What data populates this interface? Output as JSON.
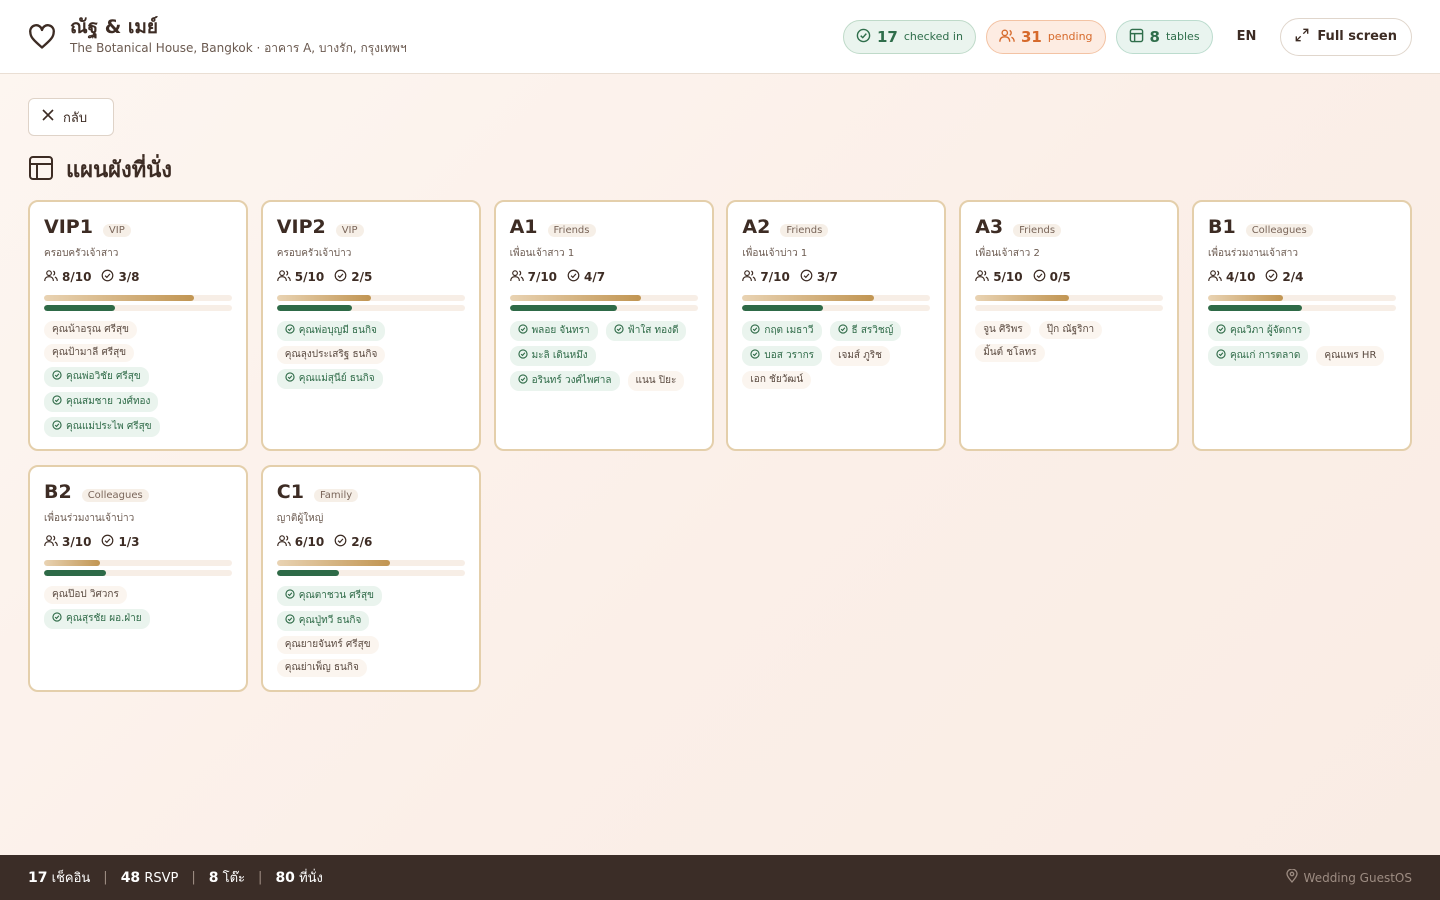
{
  "header": {
    "title": "ณัฐ & เมย์",
    "subtitle": "The Botanical House, Bangkok · อาคาร A, บางรัก, กรุงเทพฯ",
    "checked_in": {
      "count": "17",
      "label": "checked in"
    },
    "pending": {
      "count": "31",
      "label": "pending"
    },
    "tables": {
      "count": "8",
      "label": "tables"
    },
    "language": "EN",
    "fullscreen_label": "Full screen"
  },
  "back_label": "กลับ",
  "page_title": "แผนผังที่นั่ง",
  "tables": [
    {
      "name": "VIP1",
      "category": "VIP",
      "desc": "ครอบครัวเจ้าสาว",
      "seated": "8/10",
      "checked": "3/8",
      "seat_pct": 80,
      "check_pct": 37.5,
      "guests": [
        {
          "name": "คุณน้าอรุณ ศรีสุข",
          "checked": false
        },
        {
          "name": "คุณป้ามาลี ศรีสุข",
          "checked": false
        },
        {
          "name": "คุณพ่อวิชัย ศรีสุข",
          "checked": true
        },
        {
          "name": "คุณสมชาย วงศ์ทอง",
          "checked": true
        },
        {
          "name": "คุณแม่ประไพ ศรีสุข",
          "checked": true
        }
      ]
    },
    {
      "name": "VIP2",
      "category": "VIP",
      "desc": "ครอบครัวเจ้าบ่าว",
      "seated": "5/10",
      "checked": "2/5",
      "seat_pct": 50,
      "check_pct": 40,
      "guests": [
        {
          "name": "คุณพ่อบุญมี ธนกิจ",
          "checked": true
        },
        {
          "name": "คุณลุงประเสริฐ ธนกิจ",
          "checked": false
        },
        {
          "name": "คุณแม่สุนีย์ ธนกิจ",
          "checked": true
        }
      ]
    },
    {
      "name": "A1",
      "category": "Friends",
      "desc": "เพื่อนเจ้าสาว 1",
      "seated": "7/10",
      "checked": "4/7",
      "seat_pct": 70,
      "check_pct": 57,
      "guests": [
        {
          "name": "พลอย จันทรา",
          "checked": true
        },
        {
          "name": "ฟ้าใส ทองดี",
          "checked": true
        },
        {
          "name": "มะลิ เดินหมึง",
          "checked": true
        },
        {
          "name": "อรินทร์ วงศ์ไพศาล",
          "checked": true
        },
        {
          "name": "แนน ปิยะ",
          "checked": false
        }
      ]
    },
    {
      "name": "A2",
      "category": "Friends",
      "desc": "เพื่อนเจ้าบ่าว 1",
      "seated": "7/10",
      "checked": "3/7",
      "seat_pct": 70,
      "check_pct": 43,
      "guests": [
        {
          "name": "กฤต เมธาวี",
          "checked": true
        },
        {
          "name": "ธี สรวิชญ์",
          "checked": true
        },
        {
          "name": "บอส วรากร",
          "checked": true
        },
        {
          "name": "เจมส์ ภูริช",
          "checked": false
        },
        {
          "name": "เอก ชัยวัฒน์",
          "checked": false
        }
      ]
    },
    {
      "name": "A3",
      "category": "Friends",
      "desc": "เพื่อนเจ้าสาว 2",
      "seated": "5/10",
      "checked": "0/5",
      "seat_pct": 50,
      "check_pct": 0,
      "guests": [
        {
          "name": "จูน ศิริพร",
          "checked": false
        },
        {
          "name": "ปุ๊ก ณัฐริกา",
          "checked": false
        },
        {
          "name": "มิ้นต์ ชโลทร",
          "checked": false
        }
      ]
    },
    {
      "name": "B1",
      "category": "Colleagues",
      "desc": "เพื่อนร่วมงานเจ้าสาว",
      "seated": "4/10",
      "checked": "2/4",
      "seat_pct": 40,
      "check_pct": 50,
      "guests": [
        {
          "name": "คุณวิภา ผู้จัดการ",
          "checked": true
        },
        {
          "name": "คุณเก่ การตลาด",
          "checked": true
        },
        {
          "name": "คุณแพร HR",
          "checked": false
        }
      ]
    },
    {
      "name": "B2",
      "category": "Colleagues",
      "desc": "เพื่อนร่วมงานเจ้าบ่าว",
      "seated": "3/10",
      "checked": "1/3",
      "seat_pct": 30,
      "check_pct": 33,
      "guests": [
        {
          "name": "คุณป๊อป วิศวกร",
          "checked": false
        },
        {
          "name": "คุณสุรชัย ผอ.ฝ่าย",
          "checked": true
        }
      ]
    },
    {
      "name": "C1",
      "category": "Family",
      "desc": "ญาติผู้ใหญ่",
      "seated": "6/10",
      "checked": "2/6",
      "seat_pct": 60,
      "check_pct": 33,
      "guests": [
        {
          "name": "คุณตาชวน ศรีสุข",
          "checked": true
        },
        {
          "name": "คุณปู่ทวี ธนกิจ",
          "checked": true
        },
        {
          "name": "คุณยายจันทร์ ศรีสุข",
          "checked": false
        },
        {
          "name": "คุณย่าเพ็ญ ธนกิจ",
          "checked": false
        }
      ]
    }
  ],
  "footer": {
    "checkin": {
      "num": "17",
      "label": "เช็คอิน"
    },
    "rsvp": {
      "num": "48",
      "label": "RSVP"
    },
    "tables": {
      "num": "8",
      "label": "โต๊ะ"
    },
    "seats": {
      "num": "80",
      "label": "ที่นั่ง"
    },
    "brand": "Wedding GuestOS"
  },
  "colors": {
    "accent_green": "#2e6a47",
    "accent_gold": "#c19552",
    "pending_orange": "#d66a2c",
    "footer_bg": "#3b2d27"
  }
}
